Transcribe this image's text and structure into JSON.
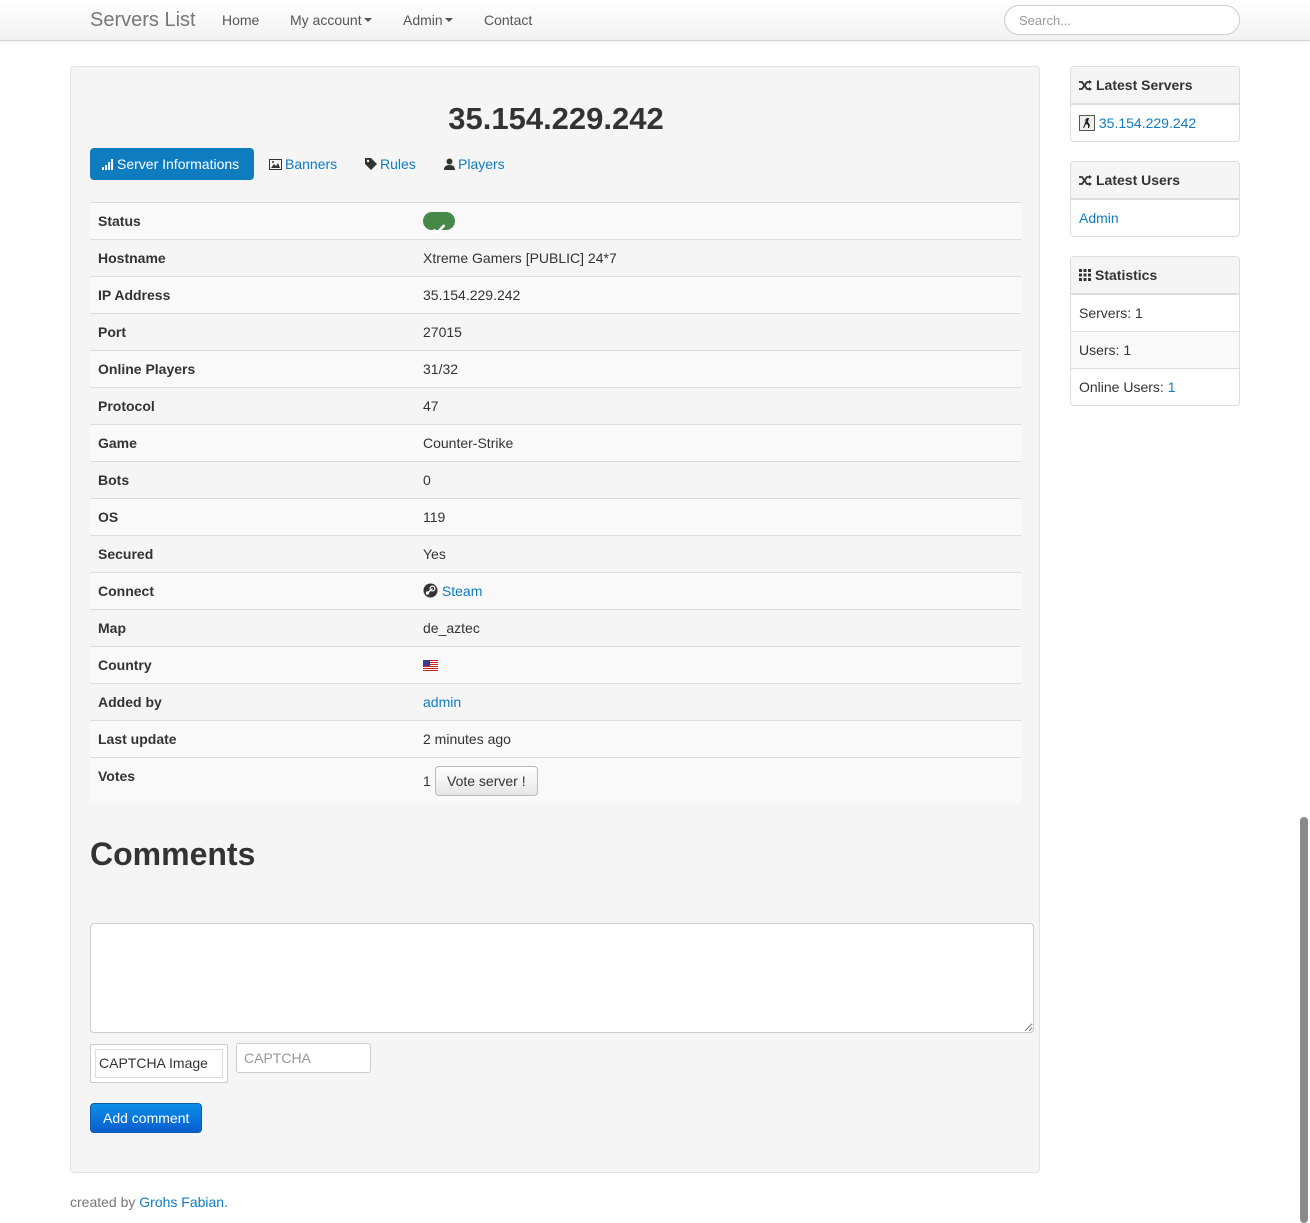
{
  "navbar": {
    "brand": "Servers List",
    "items": [
      {
        "label": "Home"
      },
      {
        "label": "My account",
        "dropdown": true
      },
      {
        "label": "Admin",
        "dropdown": true
      },
      {
        "label": "Contact"
      }
    ],
    "search_placeholder": "Search..."
  },
  "server": {
    "title": "35.154.229.242",
    "tabs": [
      {
        "label": "Server Informations",
        "icon": "signal-icon",
        "active": true
      },
      {
        "label": "Banners",
        "icon": "picture-icon"
      },
      {
        "label": "Rules",
        "icon": "tag-icon"
      },
      {
        "label": "Players",
        "icon": "user-icon"
      }
    ],
    "info": {
      "status_label": "Status",
      "hostname_label": "Hostname",
      "hostname": "Xtreme Gamers [PUBLIC] 24*7",
      "ip_label": "IP Address",
      "ip": "35.154.229.242",
      "port_label": "Port",
      "port": "27015",
      "players_label": "Online Players",
      "players": "31/32",
      "protocol_label": "Protocol",
      "protocol": "47",
      "game_label": "Game",
      "game": "Counter-Strike",
      "bots_label": "Bots",
      "bots": "0",
      "os_label": "OS",
      "os": "119",
      "secured_label": "Secured",
      "secured": "Yes",
      "connect_label": "Connect",
      "connect": "Steam",
      "map_label": "Map",
      "map": "de_aztec",
      "country_label": "Country",
      "added_label": "Added by",
      "added_by": "admin",
      "update_label": "Last update",
      "last_update": "2 minutes ago",
      "votes_label": "Votes",
      "votes": "1",
      "vote_button": "Vote server !"
    }
  },
  "comments": {
    "heading": "Comments",
    "captcha_alt": "CAPTCHA Image",
    "captcha_placeholder": "CAPTCHA",
    "submit": "Add comment"
  },
  "footer": {
    "prefix": "created by",
    "author": "Grohs Fabian."
  },
  "sidebar": {
    "latest_servers": {
      "title": "Latest Servers",
      "items": [
        "35.154.229.242"
      ]
    },
    "latest_users": {
      "title": "Latest Users",
      "items": [
        "Admin"
      ]
    },
    "statistics": {
      "title": "Statistics",
      "servers": "Servers: 1",
      "users": "Users: 1",
      "online_prefix": "Online Users:",
      "online_value": "1"
    }
  },
  "colors": {
    "link": "#0f7cc0",
    "status_ok": "#468847",
    "primary": "#0a6fd6"
  }
}
